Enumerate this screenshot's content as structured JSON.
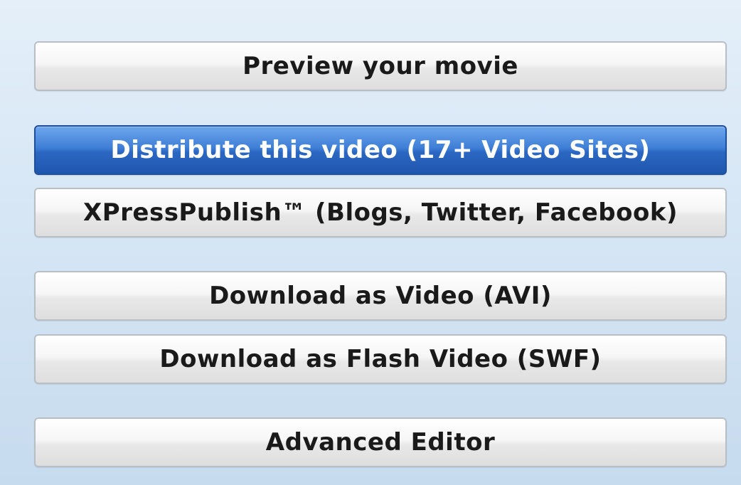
{
  "actions": {
    "preview_label": "Preview your movie",
    "distribute_label": "Distribute this video (17+ Video Sites)",
    "xpresspublish_label": "XPressPublish™ (Blogs, Twitter, Facebook)",
    "download_avi_label": "Download as Video (AVI)",
    "download_swf_label": "Download as Flash Video (SWF)",
    "advanced_editor_label": "Advanced Editor"
  },
  "colors": {
    "background_top": "#e4eff9",
    "background_bottom": "#c6dbee",
    "primary_button": "#2b67c2",
    "primary_button_border": "#1f4f9a",
    "button_text": "#1a1a1a",
    "primary_button_text": "#ffffff"
  }
}
